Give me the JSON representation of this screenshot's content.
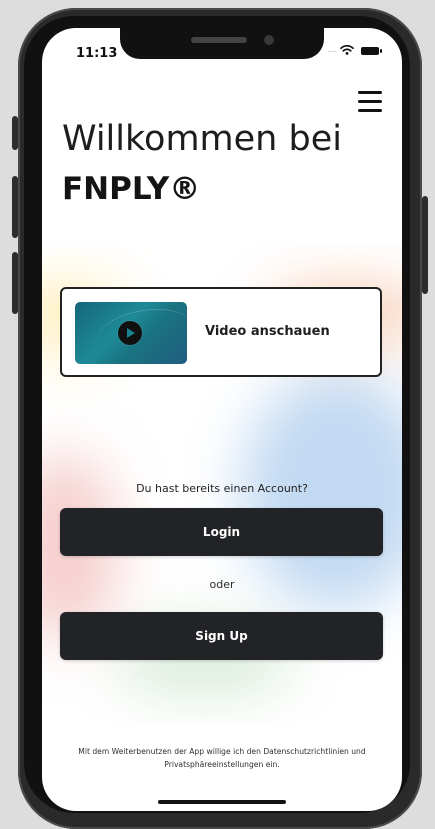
{
  "status_bar": {
    "time": "11:13",
    "signal_indicator": "....",
    "wifi_icon": "wifi-icon",
    "battery_icon": "battery-icon"
  },
  "header": {
    "menu_icon": "menu-icon"
  },
  "welcome": {
    "line_1": "Willkommen bei",
    "line_2": "FNPLY®"
  },
  "video_card": {
    "label": "Video anschauen",
    "play_icon": "play-icon"
  },
  "auth": {
    "prompt": "Du hast bereits einen Account?",
    "login_label": "Login",
    "separator": "oder",
    "signup_label": "Sign Up"
  },
  "footer": {
    "legal_text": "Mit dem Weiterbenutzen der App willige ich den Datenschutzrichtlinien und Privatsphäreeinstellungen ein."
  },
  "colors": {
    "button_dark": "#222326",
    "text_dark": "#141414",
    "accent_teal": "#1e8a97",
    "blob_orange": "#f7c1a3",
    "blob_blue": "#a3c7ec",
    "blob_red": "#eea6a6",
    "blob_green": "#bfdcc0",
    "blob_yellow": "#ffe696"
  }
}
